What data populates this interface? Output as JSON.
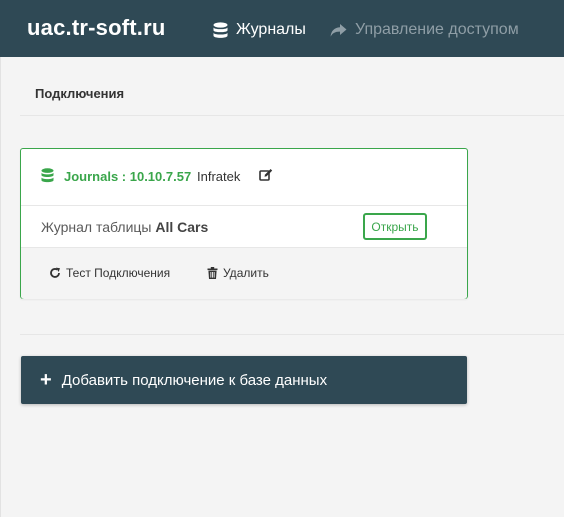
{
  "navbar": {
    "brand": "uac.tr-soft.ru",
    "items": [
      {
        "label": "Журналы",
        "icon": "database-icon",
        "active": true
      },
      {
        "label": "Управление доступом",
        "icon": "share-icon",
        "active": false
      }
    ]
  },
  "section": {
    "title": "Подключения"
  },
  "connection": {
    "title": "Journals : 10.10.7.57",
    "name": "Infratek",
    "table_prefix": "Журнал таблицы",
    "table_name": "All Cars",
    "open_label": "Открыть",
    "test_label": "Тест Подключения",
    "delete_label": "Удалить"
  },
  "add_button": {
    "label": "Добавить подключение к базе данных"
  },
  "colors": {
    "navbar": "#2f4955",
    "accent_green": "#3aa64b",
    "background": "#f4f4f4"
  }
}
